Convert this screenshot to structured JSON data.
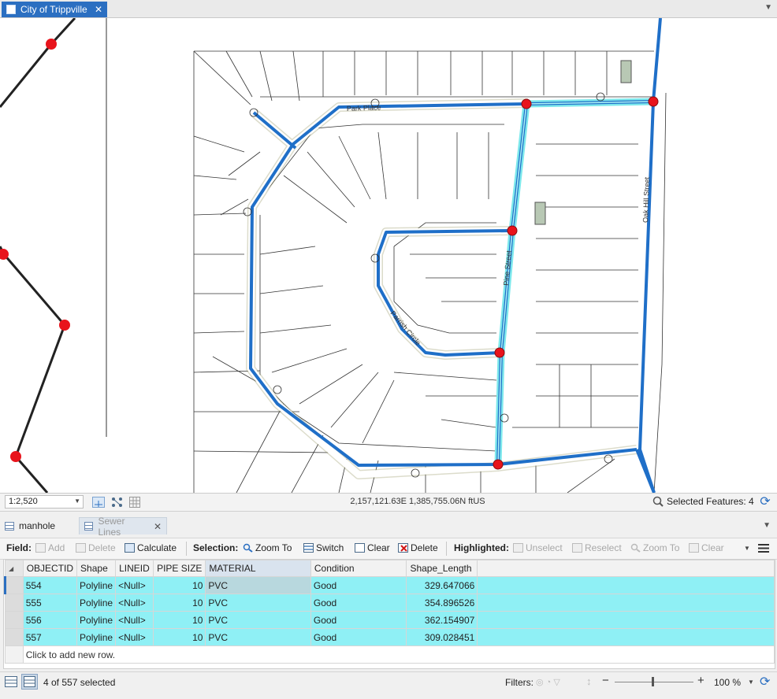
{
  "document_tab": {
    "title": "City of Trippville",
    "close": "✕"
  },
  "map": {
    "street_labels": [
      "Park Place",
      "Parrish Circle",
      "Pine Street",
      "Oak Hill Street"
    ]
  },
  "map_status": {
    "scale": "1:2,520",
    "coordinates": "2,157,121.63E 1,385,755.06N ftUS",
    "selected_features": "Selected Features: 4"
  },
  "attribute_tabs": [
    {
      "label": "manhole"
    },
    {
      "label": "Sewer Lines",
      "close": "✕"
    }
  ],
  "toolbar": {
    "field_label": "Field:",
    "add": "Add",
    "delete_field": "Delete",
    "calculate": "Calculate",
    "selection_label": "Selection:",
    "zoom_to": "Zoom To",
    "switch": "Switch",
    "clear": "Clear",
    "delete_sel": "Delete",
    "highlighted_label": "Highlighted:",
    "unselect": "Unselect",
    "reselect": "Reselect",
    "hl_zoom_to": "Zoom To",
    "hl_clear": "Clear"
  },
  "table": {
    "columns": [
      "OBJECTID",
      "Shape",
      "LINEID",
      "PIPE SIZE",
      "MATERIAL",
      "Condition",
      "Shape_Length"
    ],
    "rows": [
      [
        "554",
        "Polyline",
        "<Null>",
        "10",
        "PVC",
        "Good",
        "329.647066"
      ],
      [
        "555",
        "Polyline",
        "<Null>",
        "10",
        "PVC",
        "Good",
        "354.896526"
      ],
      [
        "556",
        "Polyline",
        "<Null>",
        "10",
        "PVC",
        "Good",
        "362.154907"
      ],
      [
        "557",
        "Polyline",
        "<Null>",
        "10",
        "PVC",
        "Good",
        "309.028451"
      ]
    ],
    "add_row": "Click to add new row."
  },
  "status": {
    "selected_count": "4 of 557 selected",
    "filters": "Filters:",
    "zoom": "100 %"
  },
  "colors": {
    "accent": "#2b6fc1",
    "selection": "#8ff0f5",
    "sewer_line": "#1f6fc8",
    "manhole": "#e8141c"
  }
}
